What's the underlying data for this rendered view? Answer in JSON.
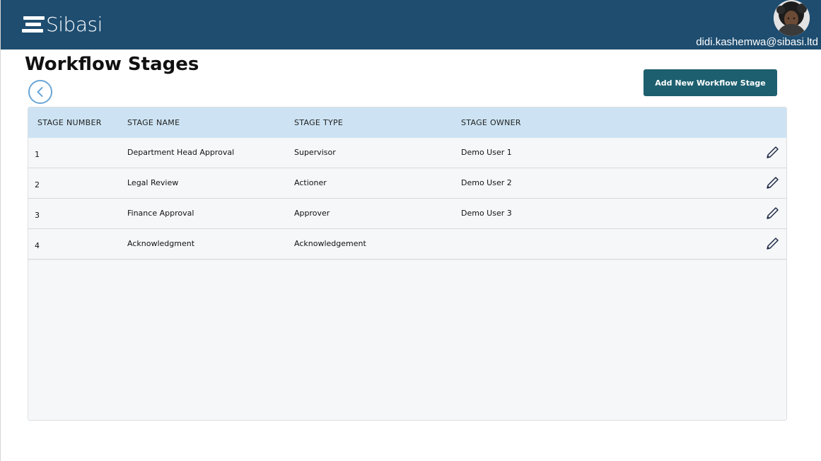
{
  "header": {
    "logo_text": "Sibasi",
    "user_email": "didi.kashemwa@sibasi.ltd",
    "brand_color": "#1e4d70"
  },
  "page": {
    "title": "Workflow Stages",
    "add_button_label": "Add New Workflow Stage",
    "back_icon": "chevron-left-icon"
  },
  "table": {
    "columns": [
      "STAGE NUMBER",
      "STAGE NAME",
      "STAGE TYPE",
      "STAGE OWNER"
    ],
    "rows": [
      {
        "number": "1",
        "name": "Department Head Approval",
        "type": "Supervisor",
        "owner": "Demo User 1"
      },
      {
        "number": "2",
        "name": "Legal Review",
        "type": "Actioner",
        "owner": "Demo User 2"
      },
      {
        "number": "3",
        "name": "Finance Approval",
        "type": "Approver",
        "owner": "Demo User 3"
      },
      {
        "number": "4",
        "name": "Acknowledgment",
        "type": "Acknowledgement",
        "owner": ""
      }
    ],
    "row_action_icon": "pencil-icon",
    "header_color": "#cde3f3"
  }
}
